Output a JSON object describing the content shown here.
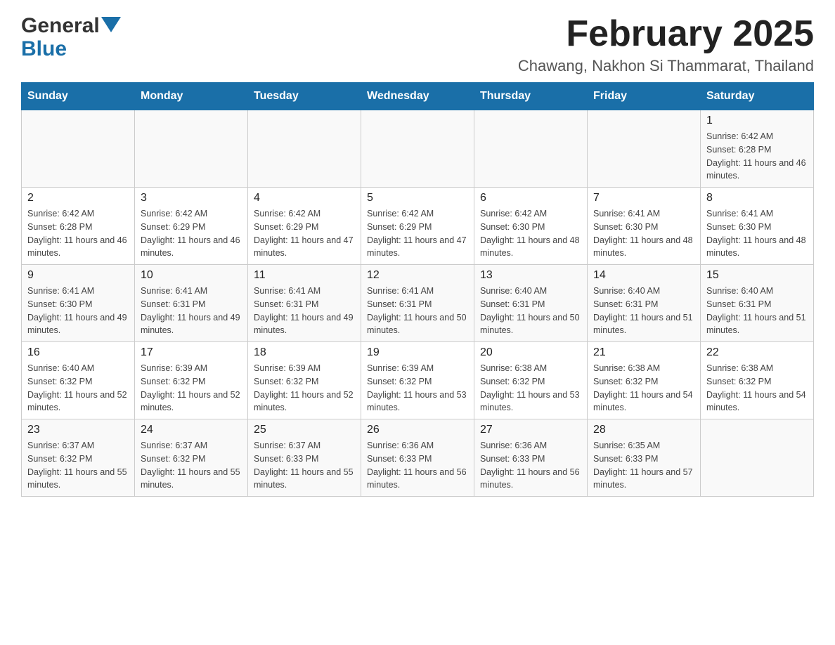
{
  "logo": {
    "general": "General",
    "blue": "Blue"
  },
  "header": {
    "month_year": "February 2025",
    "location": "Chawang, Nakhon Si Thammarat, Thailand"
  },
  "days_of_week": [
    "Sunday",
    "Monday",
    "Tuesday",
    "Wednesday",
    "Thursday",
    "Friday",
    "Saturday"
  ],
  "weeks": [
    [
      {
        "day": "",
        "info": ""
      },
      {
        "day": "",
        "info": ""
      },
      {
        "day": "",
        "info": ""
      },
      {
        "day": "",
        "info": ""
      },
      {
        "day": "",
        "info": ""
      },
      {
        "day": "",
        "info": ""
      },
      {
        "day": "1",
        "info": "Sunrise: 6:42 AM\nSunset: 6:28 PM\nDaylight: 11 hours and 46 minutes."
      }
    ],
    [
      {
        "day": "2",
        "info": "Sunrise: 6:42 AM\nSunset: 6:28 PM\nDaylight: 11 hours and 46 minutes."
      },
      {
        "day": "3",
        "info": "Sunrise: 6:42 AM\nSunset: 6:29 PM\nDaylight: 11 hours and 46 minutes."
      },
      {
        "day": "4",
        "info": "Sunrise: 6:42 AM\nSunset: 6:29 PM\nDaylight: 11 hours and 47 minutes."
      },
      {
        "day": "5",
        "info": "Sunrise: 6:42 AM\nSunset: 6:29 PM\nDaylight: 11 hours and 47 minutes."
      },
      {
        "day": "6",
        "info": "Sunrise: 6:42 AM\nSunset: 6:30 PM\nDaylight: 11 hours and 48 minutes."
      },
      {
        "day": "7",
        "info": "Sunrise: 6:41 AM\nSunset: 6:30 PM\nDaylight: 11 hours and 48 minutes."
      },
      {
        "day": "8",
        "info": "Sunrise: 6:41 AM\nSunset: 6:30 PM\nDaylight: 11 hours and 48 minutes."
      }
    ],
    [
      {
        "day": "9",
        "info": "Sunrise: 6:41 AM\nSunset: 6:30 PM\nDaylight: 11 hours and 49 minutes."
      },
      {
        "day": "10",
        "info": "Sunrise: 6:41 AM\nSunset: 6:31 PM\nDaylight: 11 hours and 49 minutes."
      },
      {
        "day": "11",
        "info": "Sunrise: 6:41 AM\nSunset: 6:31 PM\nDaylight: 11 hours and 49 minutes."
      },
      {
        "day": "12",
        "info": "Sunrise: 6:41 AM\nSunset: 6:31 PM\nDaylight: 11 hours and 50 minutes."
      },
      {
        "day": "13",
        "info": "Sunrise: 6:40 AM\nSunset: 6:31 PM\nDaylight: 11 hours and 50 minutes."
      },
      {
        "day": "14",
        "info": "Sunrise: 6:40 AM\nSunset: 6:31 PM\nDaylight: 11 hours and 51 minutes."
      },
      {
        "day": "15",
        "info": "Sunrise: 6:40 AM\nSunset: 6:31 PM\nDaylight: 11 hours and 51 minutes."
      }
    ],
    [
      {
        "day": "16",
        "info": "Sunrise: 6:40 AM\nSunset: 6:32 PM\nDaylight: 11 hours and 52 minutes."
      },
      {
        "day": "17",
        "info": "Sunrise: 6:39 AM\nSunset: 6:32 PM\nDaylight: 11 hours and 52 minutes."
      },
      {
        "day": "18",
        "info": "Sunrise: 6:39 AM\nSunset: 6:32 PM\nDaylight: 11 hours and 52 minutes."
      },
      {
        "day": "19",
        "info": "Sunrise: 6:39 AM\nSunset: 6:32 PM\nDaylight: 11 hours and 53 minutes."
      },
      {
        "day": "20",
        "info": "Sunrise: 6:38 AM\nSunset: 6:32 PM\nDaylight: 11 hours and 53 minutes."
      },
      {
        "day": "21",
        "info": "Sunrise: 6:38 AM\nSunset: 6:32 PM\nDaylight: 11 hours and 54 minutes."
      },
      {
        "day": "22",
        "info": "Sunrise: 6:38 AM\nSunset: 6:32 PM\nDaylight: 11 hours and 54 minutes."
      }
    ],
    [
      {
        "day": "23",
        "info": "Sunrise: 6:37 AM\nSunset: 6:32 PM\nDaylight: 11 hours and 55 minutes."
      },
      {
        "day": "24",
        "info": "Sunrise: 6:37 AM\nSunset: 6:32 PM\nDaylight: 11 hours and 55 minutes."
      },
      {
        "day": "25",
        "info": "Sunrise: 6:37 AM\nSunset: 6:33 PM\nDaylight: 11 hours and 55 minutes."
      },
      {
        "day": "26",
        "info": "Sunrise: 6:36 AM\nSunset: 6:33 PM\nDaylight: 11 hours and 56 minutes."
      },
      {
        "day": "27",
        "info": "Sunrise: 6:36 AM\nSunset: 6:33 PM\nDaylight: 11 hours and 56 minutes."
      },
      {
        "day": "28",
        "info": "Sunrise: 6:35 AM\nSunset: 6:33 PM\nDaylight: 11 hours and 57 minutes."
      },
      {
        "day": "",
        "info": ""
      }
    ]
  ]
}
